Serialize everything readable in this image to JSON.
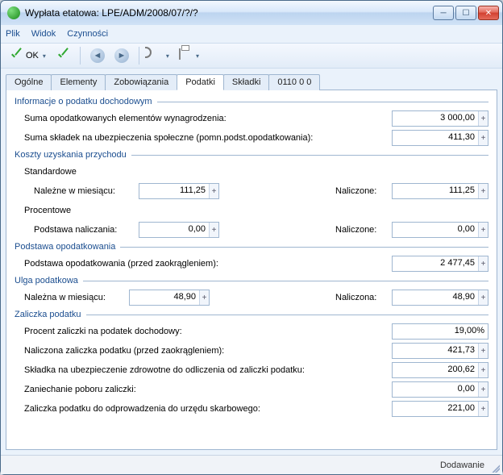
{
  "window": {
    "title": "Wypłata etatowa: LPE/ADM/2008/07/?/?"
  },
  "menu": {
    "file": "Plik",
    "view": "Widok",
    "actions": "Czynności"
  },
  "toolbar": {
    "ok": "OK"
  },
  "tabs": [
    "Ogólne",
    "Elementy",
    "Zobowiązania",
    "Podatki",
    "Składki",
    "0110 0 0"
  ],
  "status": "Dodawanie",
  "sections": {
    "info": {
      "title": "Informacje o podatku dochodowym",
      "r1": {
        "label": "Suma opodatkowanych elementów wynagrodzenia:",
        "value": "3 000,00"
      },
      "r2": {
        "label": "Suma składek na ubezpieczenia społeczne (pomn.podst.opodatkowania):",
        "value": "411,30"
      }
    },
    "koszty": {
      "title": "Koszty uzyskania przychodu",
      "std": "Standardowe",
      "std_r": {
        "label1": "Należne w miesiącu:",
        "v1": "111,25",
        "label2": "Naliczone:",
        "v2": "111,25"
      },
      "proc": "Procentowe",
      "proc_r": {
        "label1": "Podstawa naliczania:",
        "v1": "0,00",
        "label2": "Naliczone:",
        "v2": "0,00"
      }
    },
    "podst": {
      "title": "Podstawa opodatkowania",
      "r": {
        "label": "Podstawa opodatkowania  (przed zaokrągleniem):",
        "value": "2 477,45"
      }
    },
    "ulga": {
      "title": "Ulga podatkowa",
      "r": {
        "label1": "Należna w miesiącu:",
        "v1": "48,90",
        "label2": "Naliczona:",
        "v2": "48,90"
      }
    },
    "zal": {
      "title": "Zaliczka podatku",
      "r1": {
        "label": "Procent zaliczki na podatek dochodowy:",
        "value": "19,00%"
      },
      "r2": {
        "label": "Naliczona zaliczka podatku (przed zaokrągleniem):",
        "value": "421,73"
      },
      "r3": {
        "label": "Składka na ubezpieczenie zdrowotne do odliczenia od zaliczki podatku:",
        "value": "200,62"
      },
      "r4": {
        "label": "Zaniechanie poboru zaliczki:",
        "value": "0,00"
      },
      "r5": {
        "label": "Zaliczka podatku do odprowadzenia do urzędu skarbowego:",
        "value": "221,00"
      }
    }
  }
}
